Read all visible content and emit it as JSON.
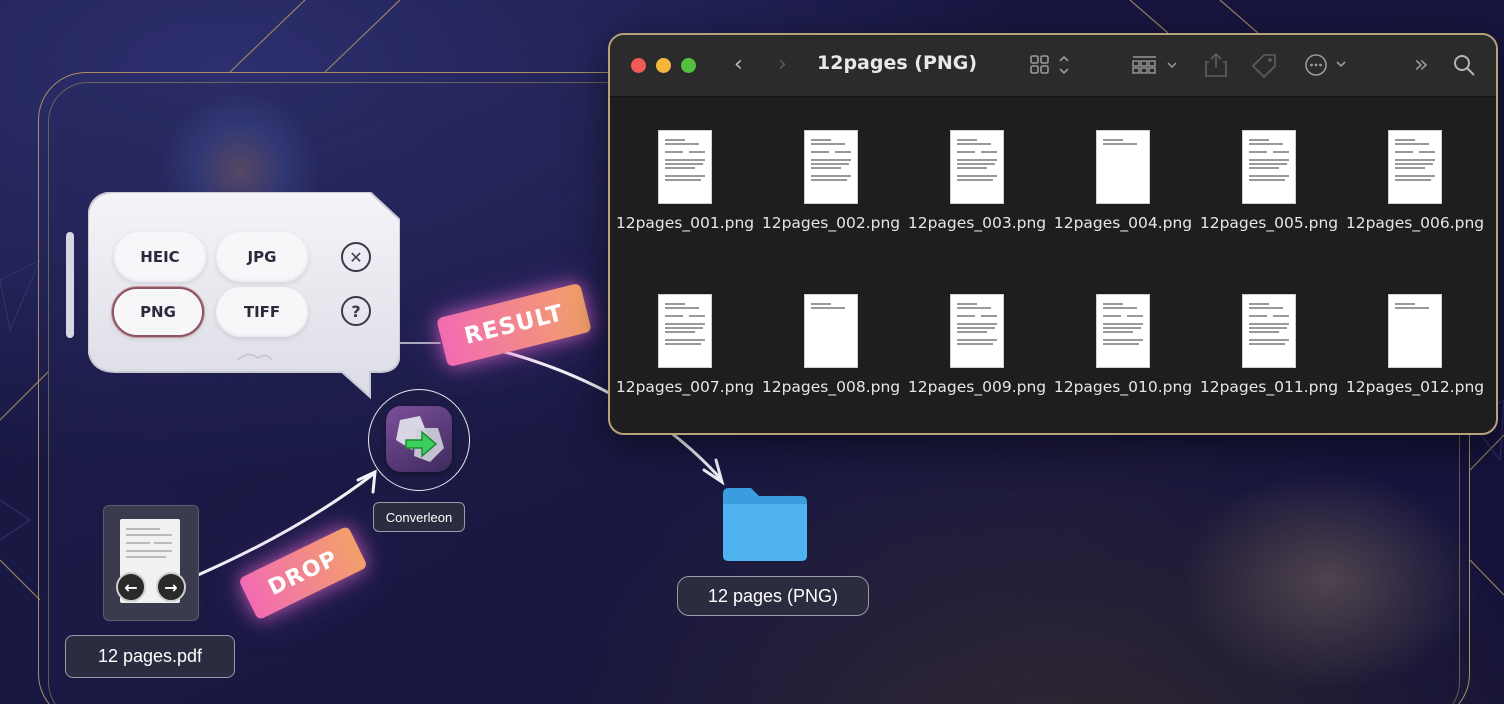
{
  "format_panel": {
    "buttons": [
      "HEIC",
      "JPG",
      "PNG",
      "TIFF"
    ],
    "selected": "PNG",
    "close_icon": "close-circle-icon",
    "help_icon": "help-circle-icon"
  },
  "tags": {
    "result": "RESULT",
    "drop": "DROP"
  },
  "app": {
    "name": "Converleon"
  },
  "source_file": {
    "name": "12 pages.pdf"
  },
  "output_folder": {
    "name": "12 pages (PNG)"
  },
  "finder": {
    "title": "12pages (PNG)",
    "files": [
      "12pages_001.png",
      "12pages_002.png",
      "12pages_003.png",
      "12pages_004.png",
      "12pages_005.png",
      "12pages_006.png",
      "12pages_007.png",
      "12pages_008.png",
      "12pages_009.png",
      "12pages_010.png",
      "12pages_011.png",
      "12pages_012.png"
    ]
  },
  "colors": {
    "background": "#181640",
    "frame": "#a88f62",
    "tag_gradient_start": "#f26bb3",
    "tag_gradient_end": "#f3a06a",
    "folder": "#4fb3ef",
    "finder_bg": "#1e1e1e"
  }
}
